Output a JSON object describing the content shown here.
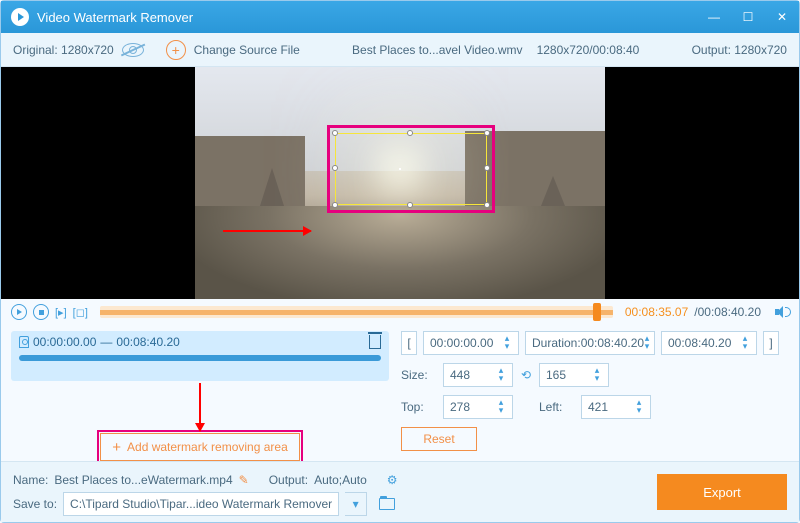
{
  "title": "Video Watermark Remover",
  "toolbar": {
    "original": "Original: 1280x720",
    "change": "Change Source File",
    "filename": "Best Places to...avel Video.wmv",
    "fileinfo": "1280x720/00:08:40",
    "output": "Output: 1280x720"
  },
  "time": {
    "current": "00:08:35.07",
    "total": "/00:08:40.20"
  },
  "segment": {
    "start": "00:00:00.00",
    "sep": " — ",
    "end": "00:08:40.20"
  },
  "add_btn": "Add watermark removing area",
  "params": {
    "bracket_l": "[",
    "start": "00:00:00.00",
    "dur_lbl": "Duration:",
    "dur": "00:08:40.20",
    "end": "00:08:40.20",
    "bracket_r": "]",
    "size_lbl": "Size:",
    "w": "448",
    "h": "165",
    "top_lbl": "Top:",
    "top": "278",
    "left_lbl": "Left:",
    "left": "421",
    "reset": "Reset"
  },
  "bottom": {
    "name_lbl": "Name:",
    "name": "Best Places to...eWatermark.mp4",
    "out_lbl": "Output:",
    "out": "Auto;Auto",
    "save_lbl": "Save to:",
    "save": "C:\\Tipard Studio\\Tipar...ideo Watermark Remover",
    "export": "Export"
  }
}
